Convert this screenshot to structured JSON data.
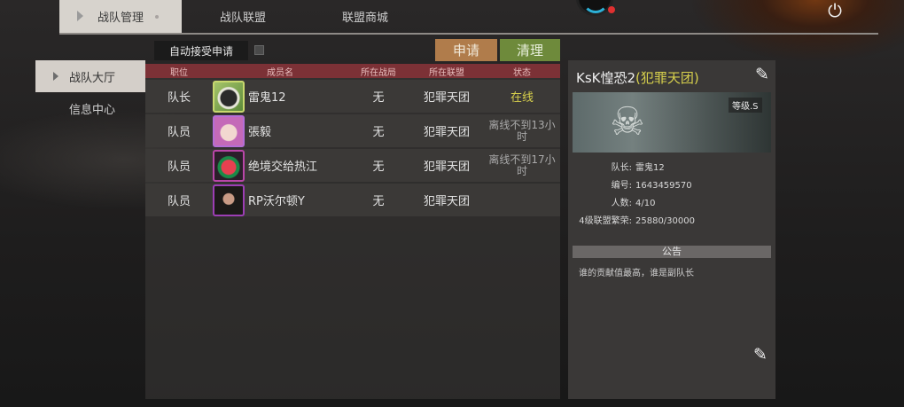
{
  "tabs": [
    "战队管理",
    "战队联盟",
    "联盟商城"
  ],
  "sidebar": [
    {
      "label": "战队大厅",
      "active": true
    },
    {
      "label": "信息中心",
      "active": false
    }
  ],
  "controls": {
    "auto_accept_label": "自动接受申请",
    "auto_accept_checked": false,
    "apply_button": "申请",
    "clear_button": "清理"
  },
  "table": {
    "headers": [
      "职位",
      "成员名",
      "所在战局",
      "所在联盟",
      "状态"
    ],
    "rows": [
      {
        "role": "队长",
        "name": "雷鬼12",
        "match": "无",
        "alliance": "犯罪天团",
        "status": "在线",
        "online": true
      },
      {
        "role": "队员",
        "name": "張毅",
        "match": "无",
        "alliance": "犯罪天团",
        "status": "离线不到13小时",
        "online": false
      },
      {
        "role": "队员",
        "name": "绝境交给热江",
        "match": "无",
        "alliance": "犯罪天团",
        "status": "离线不到17小时",
        "online": false
      },
      {
        "role": "队员",
        "name": "RP沃尔顿Y",
        "match": "无",
        "alliance": "犯罪天团",
        "status": "",
        "online": false
      }
    ]
  },
  "panel": {
    "team_name": "KsK惶恐2",
    "alliance_tag": "(犯罪天团)",
    "rank": "等级.S",
    "info": [
      {
        "key": "队长:",
        "value": "雷鬼12"
      },
      {
        "key": "编号:",
        "value": "1643459570"
      },
      {
        "key": "人数:",
        "value": "4/10"
      },
      {
        "key": "4级联盟繁荣:",
        "value": "25880/30000"
      }
    ],
    "notice_title": "公告",
    "notice_text": "谁的贡献值最高，谁是副队长"
  },
  "colors": {
    "header_bar": "#7c3136",
    "apply_button": "#b07c4b",
    "clear_button": "#6e8a3b",
    "online": "#d7d04c",
    "active_tab": "#d7d3cd"
  },
  "icons": {
    "power": "power-icon",
    "edit": "edit-icon",
    "emblem": "skull-emblem-icon"
  }
}
